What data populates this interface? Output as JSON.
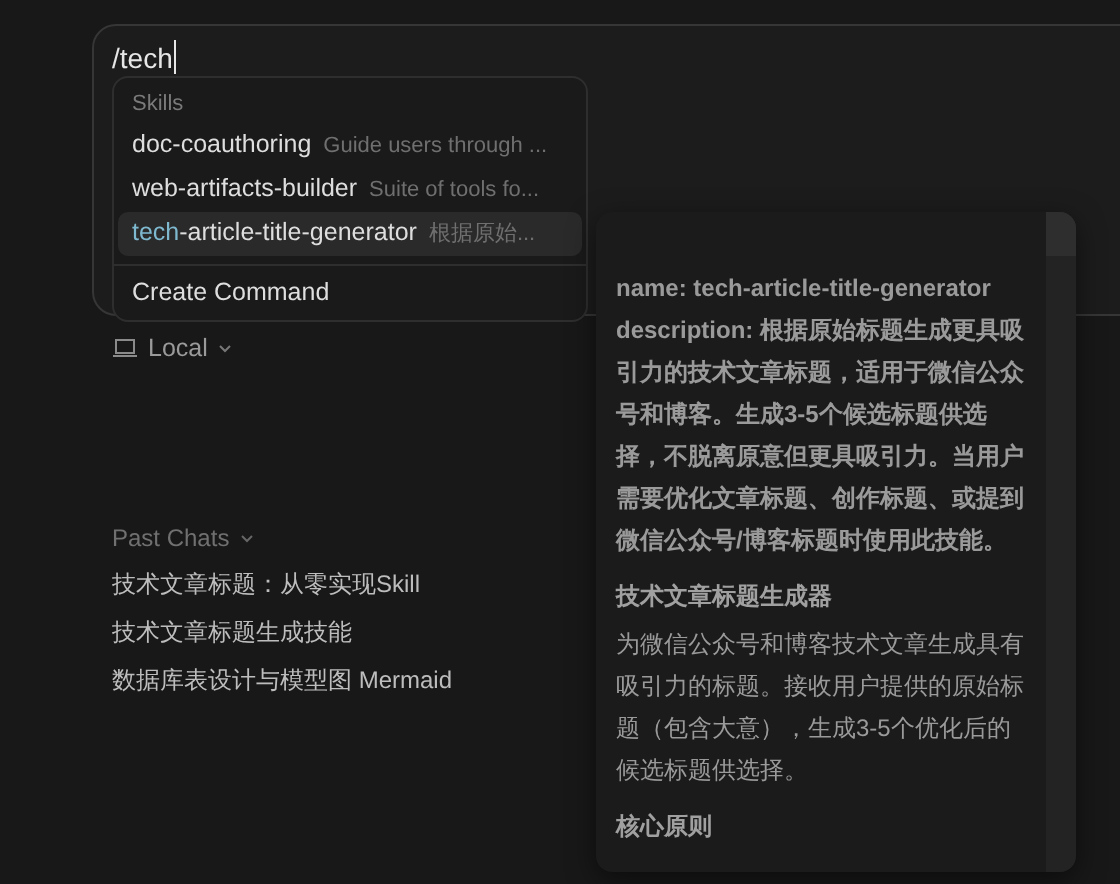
{
  "composer": {
    "value": "/tech"
  },
  "suggestions": {
    "section": "Skills",
    "items": [
      {
        "label_parts": [
          {
            "text": "doc-coauthoring",
            "matched": false
          }
        ],
        "description": "Guide users through ...",
        "selected": false
      },
      {
        "label_parts": [
          {
            "text": "web-artifacts-builder",
            "matched": false
          }
        ],
        "description": "Suite of tools fo...",
        "selected": false
      },
      {
        "label_parts": [
          {
            "text": "tech",
            "matched": true
          },
          {
            "text": "-article-title-generator",
            "matched": false
          }
        ],
        "description": "根据原始...",
        "selected": true
      }
    ],
    "action": "Create Command"
  },
  "environment": {
    "label": "Local"
  },
  "past_chats": {
    "title": "Past Chats",
    "items": [
      "技术文章标题：从零实现Skill",
      "技术文章标题生成技能",
      "数据库表设计与模型图 Mermaid"
    ]
  },
  "tooltip": {
    "blocks": [
      {
        "kind": "strong",
        "text": "name: tech-article-title-generator description: 根据原始标题生成更具吸引力的技术文章标题，适用于微信公众号和博客。生成3-5个候选标题供选择，不脱离原意但更具吸引力。当用户需要优化文章标题、创作标题、或提到微信公众号/博客标题时使用此技能。"
      },
      {
        "kind": "heading",
        "text": "技术文章标题生成器"
      },
      {
        "kind": "paragraph",
        "text": "为微信公众号和博客技术文章生成具有吸引力的标题。接收用户提供的原始标题（包含大意），生成3-5个优化后的候选标题供选择。"
      },
      {
        "kind": "heading",
        "text": "核心原则"
      }
    ]
  }
}
